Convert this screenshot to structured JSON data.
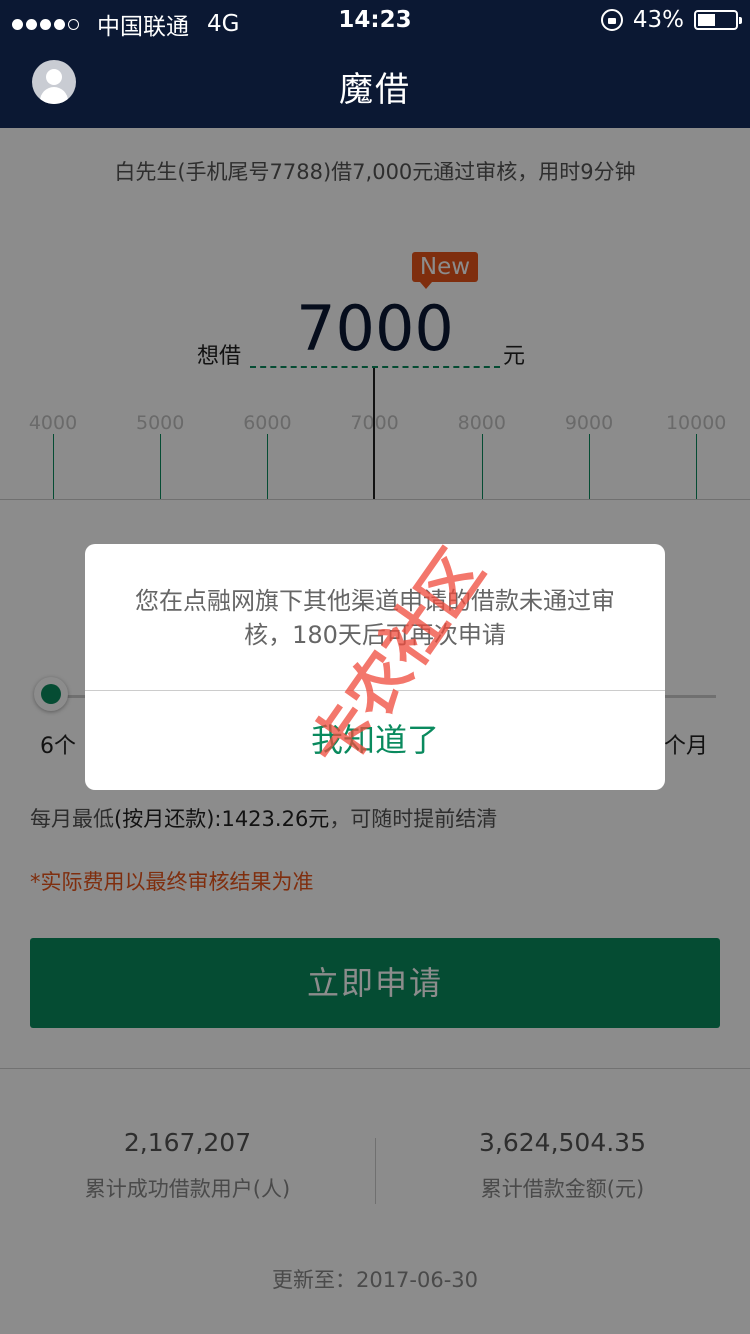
{
  "status_bar": {
    "carrier": "中国联通",
    "network": "4G",
    "time": "14:23",
    "battery": "43%",
    "battery_level": 0.43
  },
  "header": {
    "title": "魔借"
  },
  "notice": "白先生(手机尾号7788)借7,000元通过审核，用时9分钟",
  "loan": {
    "badge": "New",
    "want_label": "想借",
    "amount": "7000",
    "unit": "元",
    "ruler_ticks": [
      "4000",
      "5000",
      "6000",
      "7000",
      "8000",
      "9000",
      "10000"
    ]
  },
  "term": {
    "min_label": "6个",
    "max_label": "个月",
    "selected_fraction": 0
  },
  "repayment": {
    "monthly_prefix": "每月最低",
    "monthly_strong": "(按月还款):1423.26元",
    "monthly_suffix": "，可随时提前结清",
    "disclaimer": "*实际费用以最终审核结果为准"
  },
  "apply_button": "立即申请",
  "stats": [
    {
      "value": "2,167,207",
      "label": "累计成功借款用户(人)"
    },
    {
      "value": "3,624,504.35",
      "label": "累计借款金额(元)"
    }
  ],
  "updated": "更新至：2017-06-30",
  "dialog": {
    "message": "您在点融网旗下其他渠道申请的借款未通过审核，180天后可再次申请",
    "confirm": "我知道了"
  },
  "watermark_text": "卡农社区",
  "colors": {
    "header_bg": "#0b1833",
    "accent_green": "#0a8a5e",
    "orange": "#e8541a",
    "watermark": "#f04a3c"
  }
}
